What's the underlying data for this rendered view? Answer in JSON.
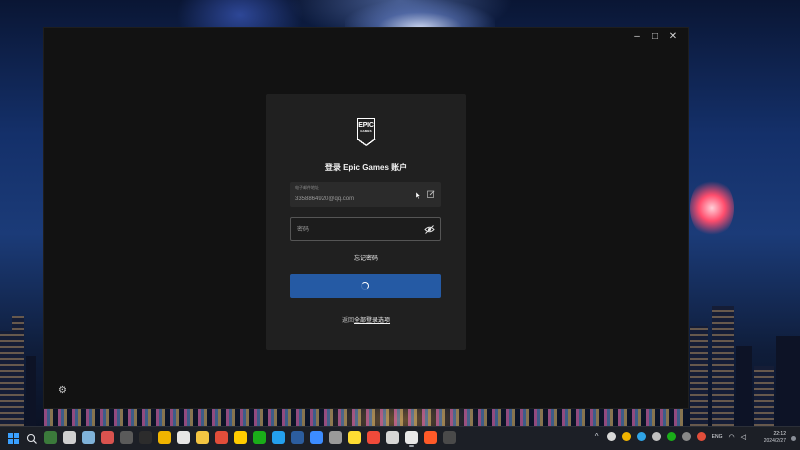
{
  "window": {
    "controls": {
      "minimize": "–",
      "maximize": "□",
      "close": "✕"
    }
  },
  "login": {
    "logo_top": "EPIC",
    "logo_bottom": "GAMES",
    "title": "登录 Epic Games 账户",
    "email": {
      "label": "电子邮件地址",
      "value": "3358864920@qq.com"
    },
    "password": {
      "placeholder": "密码"
    },
    "forgot_label": "忘记密码",
    "back_prefix": "返回",
    "back_highlight": "全部登录选项"
  },
  "taskbar": {
    "language": "ENG",
    "time": "22:12",
    "date": "2024/2/27",
    "icon_colors": [
      "#3b7a3b",
      "#cfcfcf",
      "#7fb2d9",
      "#d9534f",
      "#5a5a5a",
      "#2c2c2c",
      "#f0b400",
      "#e6e6e6",
      "#f4c542",
      "#e14d3a",
      "#ffcc00",
      "#1aad19",
      "#24a0ed",
      "#2c5d9e",
      "#3c8cff",
      "#9a9a9a",
      "#ffdd33",
      "#f04a3a",
      "#d6d6d6",
      "#e8e8e8",
      "#ff5a28",
      "#4a4a4a"
    ]
  },
  "colors": {
    "accent": "#255aa4",
    "card_bg": "#202020",
    "window_bg": "#121212"
  }
}
